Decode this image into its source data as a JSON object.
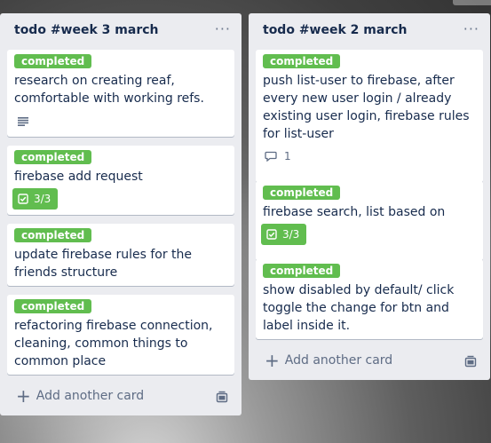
{
  "lists": [
    {
      "title": "todo #week 3 march",
      "menu_icon": "ellipsis-icon",
      "cards": [
        {
          "label": "completed",
          "title": "research on creating reaf, comfortable with working refs.",
          "badge": "description-icon"
        },
        {
          "label": "completed",
          "title": "firebase add request",
          "checklist": "3/3"
        },
        {
          "label": "completed",
          "title": "update firebase rules for the friends structure"
        },
        {
          "label": "completed",
          "title": "refactoring firebase connection, cleaning, common things to common place"
        }
      ],
      "add_label": "Add another card"
    },
    {
      "title": "todo #week 2 march",
      "menu_icon": "ellipsis-icon",
      "cards": [
        {
          "label": "completed",
          "title": "push list-user to firebase, after every new user login / already existing user login, firebase rules for list-user",
          "comments": "1"
        },
        {
          "label": "completed",
          "title": "firebase search, list based on search",
          "checklist": "3/3"
        },
        {
          "label": "completed",
          "title": "show disabled by default/ click toggle the change for btn and label inside it."
        }
      ],
      "add_label": "Add another card"
    }
  ],
  "colors": {
    "label_green": "#61bd4f",
    "list_bg": "#ebecf0",
    "text": "#172b4d",
    "muted": "#5e6c84"
  }
}
